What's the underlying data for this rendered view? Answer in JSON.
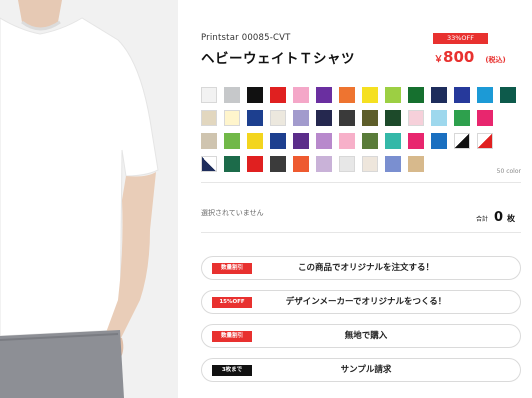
{
  "product": {
    "code": "Printstar  00085-CVT",
    "name": "ヘビーウェイトＴシャツ"
  },
  "price": {
    "discount_badge": "33%OFF",
    "yen_mark": "￥",
    "amount": "800",
    "tax_note": "(税込)"
  },
  "colors": {
    "count_label": "50 color",
    "swatches": [
      [
        "#f2f2f2",
        "#c6c8ca",
        "#111111",
        "#e02020",
        "#f4a7c8",
        "#6a2fa0",
        "#ee7430",
        "#f5e021",
        "#9ccf43",
        "#16702f",
        "#1e2d5c",
        "#26399b",
        "#1c9ad6",
        "#0d5a4b"
      ],
      [
        "#e2d7bf",
        "#fff5cc",
        "#1d3f8f",
        "#ece8de",
        "#a29bcd",
        "#25284f",
        "#3a3a3a",
        "#5e5e2a",
        "#1d4a2a",
        "#f6d0da",
        "#9ed8ed",
        "#2ea04d",
        "#e8266e"
      ],
      [
        "#cfc4af",
        "#71b848",
        "#f3d51e",
        "#1d3f8f",
        "#5b2d8a",
        "#b889cc",
        "#f7b0c9",
        "#5a7c3a",
        "#34b8a8",
        "#e8266e",
        "#1a6fc0",
        "diag-bk",
        "diag-rw"
      ],
      [
        "diag-nw",
        "#1c6b4a",
        "#e02020",
        "#3b3b3b",
        "#ee5a30",
        "#c9b2d8",
        "#e7e7e7",
        "#eee6dc",
        "#7a8fd0",
        "#d7b98c"
      ]
    ]
  },
  "selection": {
    "status": "選択されていません",
    "total_label": "合計",
    "total_value": "0",
    "total_unit": "枚"
  },
  "actions": [
    {
      "tag": "数量割引",
      "tag_color": "red",
      "label": "この商品でオリジナルを注文する！"
    },
    {
      "tag": "15%OFF",
      "tag_color": "red",
      "label": "デザインメーカーでオリジナルをつくる！"
    },
    {
      "tag": "数量割引",
      "tag_color": "red",
      "label": "無地で購入"
    },
    {
      "tag": "3枚まで",
      "tag_color": "black",
      "label": "サンプル請求"
    }
  ]
}
